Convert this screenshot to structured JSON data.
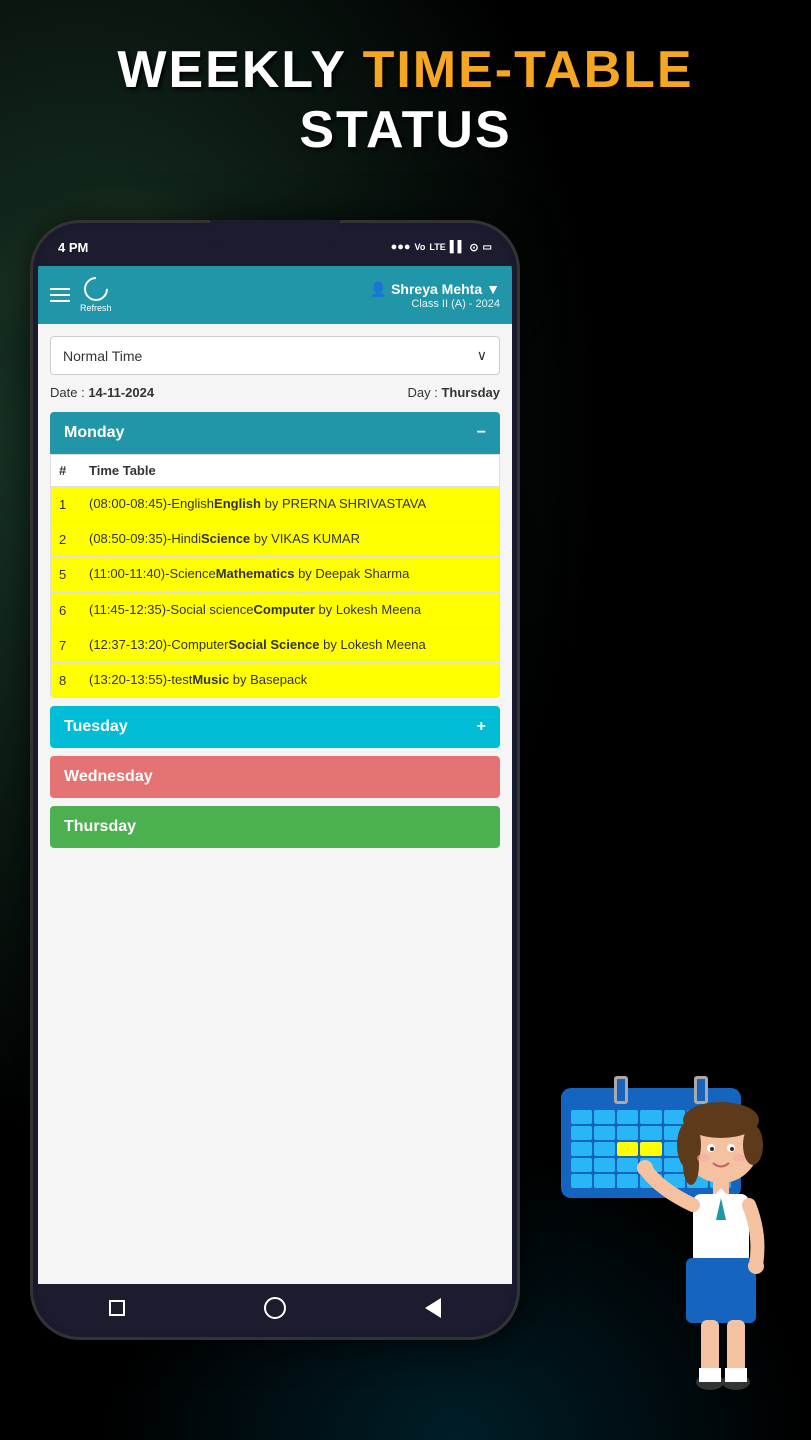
{
  "page": {
    "title_part1": "WEEKLY ",
    "title_orange": "TIME-TABLE",
    "title_line2": "STATUS"
  },
  "status_bar": {
    "time": "4 PM",
    "icons": "●●● Vo LTE ▌▌ ⊙"
  },
  "app_header": {
    "user_icon": "👤",
    "user_name": "Shreya Mehta",
    "dropdown_arrow": "▼",
    "class_info": "Class II (A) - 2024",
    "refresh_label": "Refresh"
  },
  "filter": {
    "dropdown_label": "Normal Time",
    "dropdown_arrow": "∨"
  },
  "date_row": {
    "date_label": "Date :",
    "date_value": "14-11-2024",
    "day_label": "Day :",
    "day_value": "Thursday"
  },
  "days": [
    {
      "name": "Monday",
      "color_class": "monday",
      "expanded": true,
      "toggle_icon": "−",
      "rows": [
        {
          "num": "1",
          "text_before": "(08:00-08:45)-English",
          "text_bold": "English",
          "text_after": " by PRERNA SHRIVASTAVA"
        },
        {
          "num": "2",
          "text_before": "(08:50-09:35)-Hindi",
          "text_bold": "Science",
          "text_after": " by VIKAS KUMAR"
        },
        {
          "num": "5",
          "text_before": "(11:00-11:40)-Science",
          "text_bold": "Mathematics",
          "text_after": " by Deepak Sharma"
        },
        {
          "num": "6",
          "text_before": "(11:45-12:35)-Social science",
          "text_bold": "Computer",
          "text_after": " by Lokesh Meena"
        },
        {
          "num": "7",
          "text_before": "(12:37-13:20)-Computer",
          "text_bold": "Social Science",
          "text_after": " by Lokesh Meena"
        },
        {
          "num": "8",
          "text_before": "(13:20-13:55)-test",
          "text_bold": "Music",
          "text_after": " by Basepack"
        }
      ]
    },
    {
      "name": "Tuesday",
      "color_class": "tuesday",
      "expanded": false,
      "toggle_icon": "+"
    },
    {
      "name": "Wednesday",
      "color_class": "wednesday",
      "expanded": false,
      "toggle_icon": ""
    },
    {
      "name": "Thursday",
      "color_class": "thursday",
      "expanded": false,
      "toggle_icon": ""
    }
  ],
  "table_header": {
    "col_num": "#",
    "col_subject": "Time Table"
  },
  "bottom_nav": {
    "square": "■",
    "circle": "●",
    "triangle": "◄"
  }
}
